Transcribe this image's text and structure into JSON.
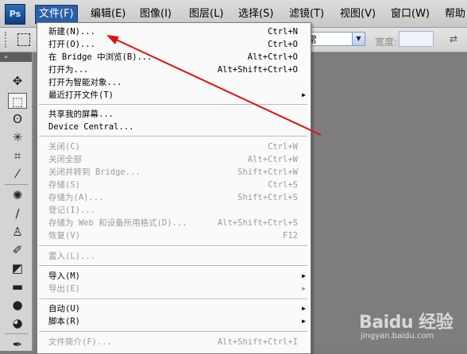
{
  "app": {
    "logo": "Ps"
  },
  "menubar": {
    "items": [
      {
        "label": "文件(F)",
        "active": true
      },
      {
        "label": "编辑(E)"
      },
      {
        "label": "图像(I)"
      },
      {
        "label": "图层(L)"
      },
      {
        "label": "选择(S)"
      },
      {
        "label": "滤镜(T)"
      },
      {
        "label": "视图(V)"
      },
      {
        "label": "窗口(W)"
      },
      {
        "label": "帮助"
      }
    ],
    "active_color": "#2b5fa7"
  },
  "options_bar": {
    "style_value": "常",
    "width_label": "宽度:"
  },
  "toolbox": {
    "header": "»",
    "tools": [
      "move-icon",
      "marquee-icon",
      "lasso-icon",
      "magic-wand-icon",
      "crop-icon",
      "eyedropper-icon",
      "healing-icon",
      "brush-icon",
      "clone-stamp-icon",
      "history-brush-icon",
      "eraser-icon",
      "gradient-icon",
      "blur-icon",
      "dodge-icon",
      "pen-icon"
    ]
  },
  "file_menu": {
    "items": [
      {
        "label": "新建(N)...",
        "shortcut": "Ctrl+N"
      },
      {
        "label": "打开(O)...",
        "shortcut": "Ctrl+O"
      },
      {
        "label": "在 Bridge 中浏览(B)...",
        "shortcut": "Alt+Ctrl+O"
      },
      {
        "label": "打开为...",
        "shortcut": "Alt+Shift+Ctrl+O"
      },
      {
        "label": "打开为智能对象...",
        "shortcut": ""
      },
      {
        "label": "最近打开文件(T)",
        "shortcut": "",
        "submenu": true
      },
      {
        "label": "共享我的屏幕...",
        "shortcut": ""
      },
      {
        "label": "Device Central...",
        "shortcut": ""
      },
      {
        "label": "关闭(C)",
        "shortcut": "Ctrl+W",
        "disabled": true
      },
      {
        "label": "关闭全部",
        "shortcut": "Alt+Ctrl+W",
        "disabled": true
      },
      {
        "label": "关闭并转到 Bridge...",
        "shortcut": "Shift+Ctrl+W",
        "disabled": true
      },
      {
        "label": "存储(S)",
        "shortcut": "Ctrl+S",
        "disabled": true
      },
      {
        "label": "存储为(A)...",
        "shortcut": "Shift+Ctrl+S",
        "disabled": true
      },
      {
        "label": "登记(I)...",
        "shortcut": "",
        "disabled": true
      },
      {
        "label": "存储为 Web 和设备所用格式(D)...",
        "shortcut": "Alt+Shift+Ctrl+S",
        "disabled": true
      },
      {
        "label": "恢复(V)",
        "shortcut": "F12",
        "disabled": true
      },
      {
        "label": "置入(L)...",
        "shortcut": "",
        "disabled": true
      },
      {
        "label": "导入(M)",
        "shortcut": "",
        "submenu": true
      },
      {
        "label": "导出(E)",
        "shortcut": "",
        "submenu": true,
        "disabled": true
      },
      {
        "label": "自动(U)",
        "shortcut": "",
        "submenu": true
      },
      {
        "label": "脚本(R)",
        "shortcut": "",
        "submenu": true
      },
      {
        "label": "文件简介(F)...",
        "shortcut": "Alt+Shift+Ctrl+I",
        "disabled": true
      }
    ]
  },
  "annotation": {
    "color": "#e01010"
  },
  "watermark": {
    "brand": "Baidu 经验",
    "sub": "jingyan.baidu.com"
  }
}
